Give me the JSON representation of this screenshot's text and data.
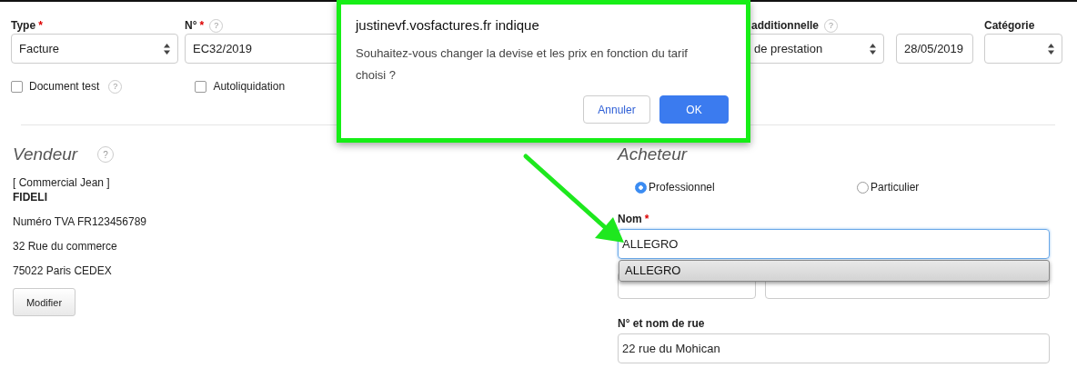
{
  "top_fields": [
    {
      "label": "Type",
      "required_mark": "*",
      "kind": "select",
      "value": "Facture"
    },
    {
      "label": "N°",
      "required_mark": "*",
      "help": "?",
      "kind": "input",
      "value": "EC32/2019"
    },
    {
      "label": "additionnelle",
      "help": "?",
      "kind": "select",
      "value": "de prestation"
    },
    {
      "kind": "input",
      "value": "28/05/2019"
    },
    {
      "label": "Catégorie",
      "kind": "select"
    }
  ],
  "options": [
    {
      "label": "Document test",
      "checked": false,
      "help": "?"
    },
    {
      "label": "Autoliquidation",
      "checked": false
    }
  ],
  "seller": {
    "title": "Vendeur",
    "help": "?",
    "lines": [
      {
        "text": "[ Commercial Jean ]",
        "bold": false
      },
      {
        "text": "FIDELI",
        "bold": true
      },
      {
        "text": "Numéro TVA FR123456789",
        "bold": false
      },
      {
        "text": "32 Rue du commerce",
        "bold": false
      },
      {
        "text": "75022 Paris CEDEX",
        "bold": false
      }
    ],
    "button": "Modifier"
  },
  "buyer": {
    "title": "Acheteur",
    "types": [
      {
        "label": "Professionnel",
        "selected": true
      },
      {
        "label": "Particulier",
        "selected": false
      }
    ],
    "name": {
      "label": "Nom",
      "required_mark": "*",
      "value": "ALLEGRO",
      "suggestions": [
        "ALLEGRO"
      ]
    },
    "street": {
      "label": "N° et nom de rue",
      "value": "22 rue du Mohican"
    }
  },
  "dialog": {
    "title": "justinevf.vosfactures.fr indique",
    "message": "Souhaitez-vous changer la devise et les prix en fonction du tarif choisi ?",
    "buttons": [
      {
        "label": "Annuler",
        "kind": "secondary"
      },
      {
        "label": "OK",
        "kind": "primary"
      }
    ]
  }
}
